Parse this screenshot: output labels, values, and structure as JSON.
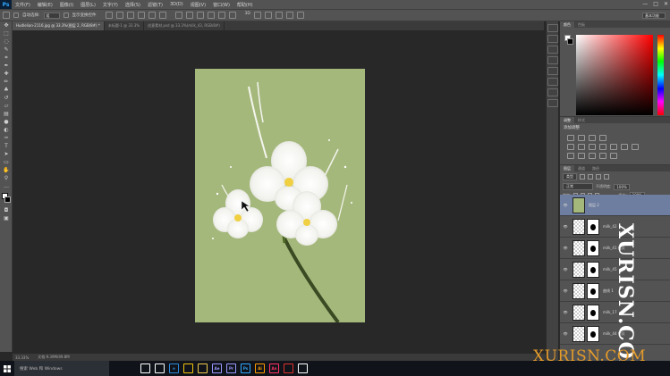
{
  "app": {
    "logo": "Ps"
  },
  "menu": [
    "文件(F)",
    "编辑(E)",
    "图像(I)",
    "图层(L)",
    "文字(Y)",
    "选择(S)",
    "滤镜(T)",
    "3D(D)",
    "视图(V)",
    "窗口(W)",
    "帮助(H)"
  ],
  "window_controls": {
    "minimize": "—",
    "restore": "□",
    "close": "✕"
  },
  "options": {
    "auto_select_label": "自动选择:",
    "auto_select_value": "组",
    "show_transform_label": "显示变换控件",
    "workspace": "基本功能"
  },
  "tabs": [
    {
      "label": "Hudlelian-2116.jpg @ 33.3%(图层 2, RGB/8#) *",
      "active": true
    },
    {
      "label": "未标题-1 @ 33.3%",
      "active": false
    },
    {
      "label": "创意素材.psd @ 33.3%(milk_43, RGB/8#)",
      "active": false
    }
  ],
  "status": {
    "zoom": "33.33%",
    "doc": "文档:9.39M/49.8M"
  },
  "color_panel": {
    "tabs": [
      "颜色",
      "色板"
    ]
  },
  "adjustments": {
    "tabs": [
      "调整",
      "样式"
    ],
    "add_label": "添加调整"
  },
  "layers_panel": {
    "tabs": [
      "图层",
      "通道",
      "路径"
    ],
    "filter": "类型",
    "blend_mode": "正常",
    "opacity_label": "不透明度:",
    "opacity": "100%",
    "lock_label": "锁定:",
    "fill_label": "填充:",
    "fill": "100%",
    "layers": [
      {
        "name": "图层 2",
        "selected": true,
        "mask": false
      },
      {
        "name": "milk_42",
        "selected": false,
        "mask": true
      },
      {
        "name": "milk_41 拷贝",
        "selected": false,
        "mask": true
      },
      {
        "name": "milk_45",
        "selected": false,
        "mask": true
      },
      {
        "name": "曲线 1",
        "selected": false,
        "mask": true
      },
      {
        "name": "milk_17",
        "selected": false,
        "mask": true
      },
      {
        "name": "milk_44 拷贝",
        "selected": false,
        "mask": true
      }
    ]
  },
  "taskbar": {
    "search_placeholder": "搜索 Web 和 Windows",
    "apps": [
      {
        "icon": "task-view-icon",
        "label": "",
        "color": "#ffffff"
      },
      {
        "icon": "store-icon",
        "label": "",
        "color": "#ffffff"
      },
      {
        "icon": "edge-icon",
        "label": "e",
        "color": "#2b88d8"
      },
      {
        "icon": "chrome-icon",
        "label": "",
        "color": "#f4c20d"
      },
      {
        "icon": "folder-icon",
        "label": "",
        "color": "#f2c94c"
      },
      {
        "icon": "after-effects-icon",
        "label": "Ae",
        "color": "#9999ff"
      },
      {
        "icon": "premiere-icon",
        "label": "Pr",
        "color": "#9999ff"
      },
      {
        "icon": "photoshop-icon",
        "label": "Ps",
        "color": "#31a8ff"
      },
      {
        "icon": "illustrator-icon",
        "label": "Ai",
        "color": "#ff9a00"
      },
      {
        "icon": "animate-icon",
        "label": "An",
        "color": "#ff3366"
      },
      {
        "icon": "record-icon",
        "label": "",
        "color": "#e0302b"
      },
      {
        "icon": "photos-icon",
        "label": "",
        "color": "#ffffff"
      }
    ]
  },
  "watermarks": {
    "vertical": "XURISN.COM",
    "bottom": "XURISN.COM"
  }
}
